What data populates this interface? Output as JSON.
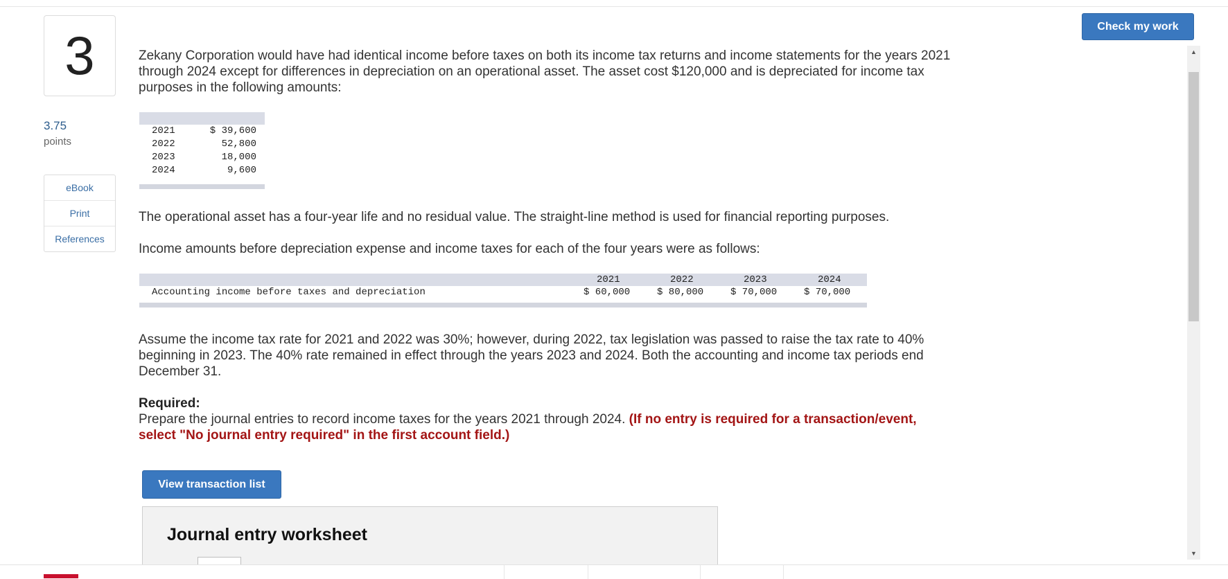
{
  "question": {
    "number": "3",
    "points_value": "3.75",
    "points_label": "points"
  },
  "side_links": [
    "eBook",
    "Print",
    "References"
  ],
  "header": {
    "check_button": "Check my work"
  },
  "intro_text": "Zekany Corporation would have had identical income before taxes on both its income tax returns and income statements for the years 2021 through 2024 except for differences in depreciation on an operational asset. The asset cost $120,000 and is depreciated for income tax purposes in the following amounts:",
  "tax_depreciation": [
    {
      "year": "2021",
      "amount": "$ 39,600"
    },
    {
      "year": "2022",
      "amount": "52,800"
    },
    {
      "year": "2023",
      "amount": "18,000"
    },
    {
      "year": "2024",
      "amount": "9,600"
    }
  ],
  "asset_text": "The operational asset has a four-year life and no residual value. The straight-line method is used for financial reporting purposes.",
  "income_intro": "Income amounts before depreciation expense and income taxes for each of the four years were as follows:",
  "income_table": {
    "years": [
      "2021",
      "2022",
      "2023",
      "2024"
    ],
    "row_label": "Accounting income before taxes and depreciation",
    "values": [
      "$ 60,000",
      "$ 80,000",
      "$ 70,000",
      "$ 70,000"
    ]
  },
  "tax_rate_text": "Assume the income tax rate for 2021 and 2022 was 30%; however, during 2022, tax legislation was passed to raise the tax rate to 40% beginning in 2023. The 40% rate remained in effect through the years 2023 and 2024. Both the accounting and income tax periods end December 31.",
  "required": {
    "title": "Required:",
    "text": "Prepare the journal entries to record income taxes for the years 2021 through 2024. ",
    "note": "(If no entry is required for a transaction/event, select \"No journal entry required\" in the first account field.)"
  },
  "view_button": "View transaction list",
  "worksheet_title": "Journal entry worksheet",
  "colors": {
    "accent": "#3a78bf",
    "note_red": "#a31515",
    "table_band": "#d9dce6"
  },
  "scrollbar": {
    "up_icon": "triangle-up",
    "down_icon": "triangle-down"
  }
}
